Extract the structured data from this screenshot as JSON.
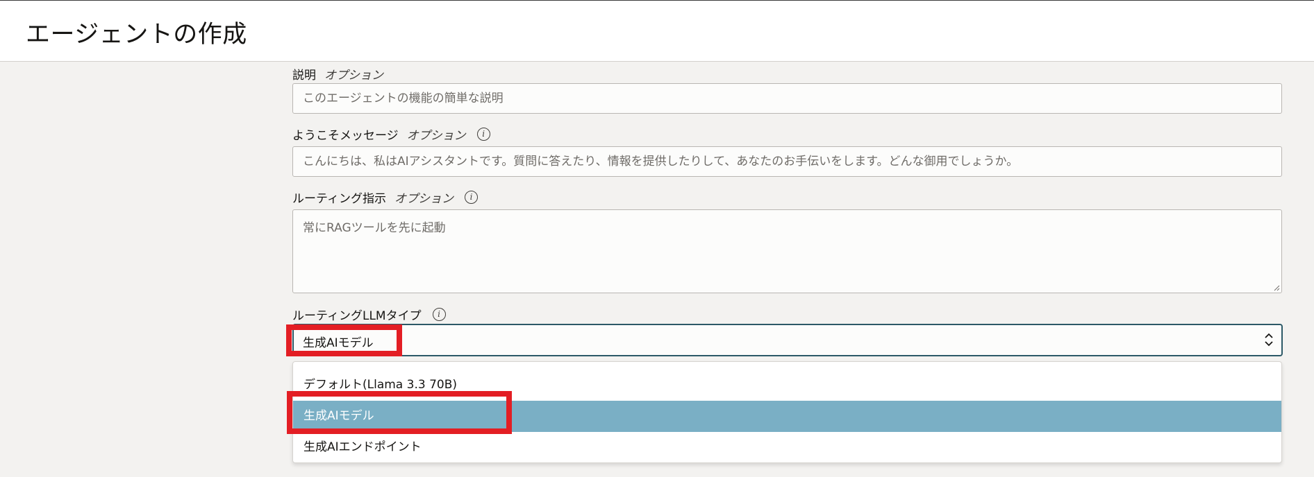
{
  "header": {
    "title": "エージェントの作成"
  },
  "description_field": {
    "label": "説明",
    "optional": "オプション",
    "placeholder": "このエージェントの機能の簡単な説明"
  },
  "welcome_field": {
    "label": "ようこそメッセージ",
    "optional": "オプション",
    "info_icon": "i",
    "placeholder": "こんにちは、私はAIアシスタントです。質問に答えたり、情報を提供したりして、あなたのお手伝いをします。どんな御用でしょうか。"
  },
  "routing_instructions_field": {
    "label": "ルーティング指示",
    "optional": "オプション",
    "info_icon": "i",
    "placeholder": "常にRAGツールを先に起動"
  },
  "routing_llm_field": {
    "label": "ルーティングLLMタイプ",
    "info_icon": "i",
    "selected_value": "生成AIモデル",
    "options": [
      "デフォルト(Llama 3.3 70B)",
      "生成AIモデル",
      "生成AIエンドポイント"
    ],
    "selected_index": 1
  },
  "colors": {
    "page_background": "#f3f2f0",
    "header_background": "#ffffff",
    "select_border": "#2c5967",
    "selected_option": "#7aafc5",
    "highlight_annotation": "#e31e24"
  },
  "icons": [
    "info-icon",
    "chevron-updown-icon",
    "resize-handle-icon"
  ]
}
